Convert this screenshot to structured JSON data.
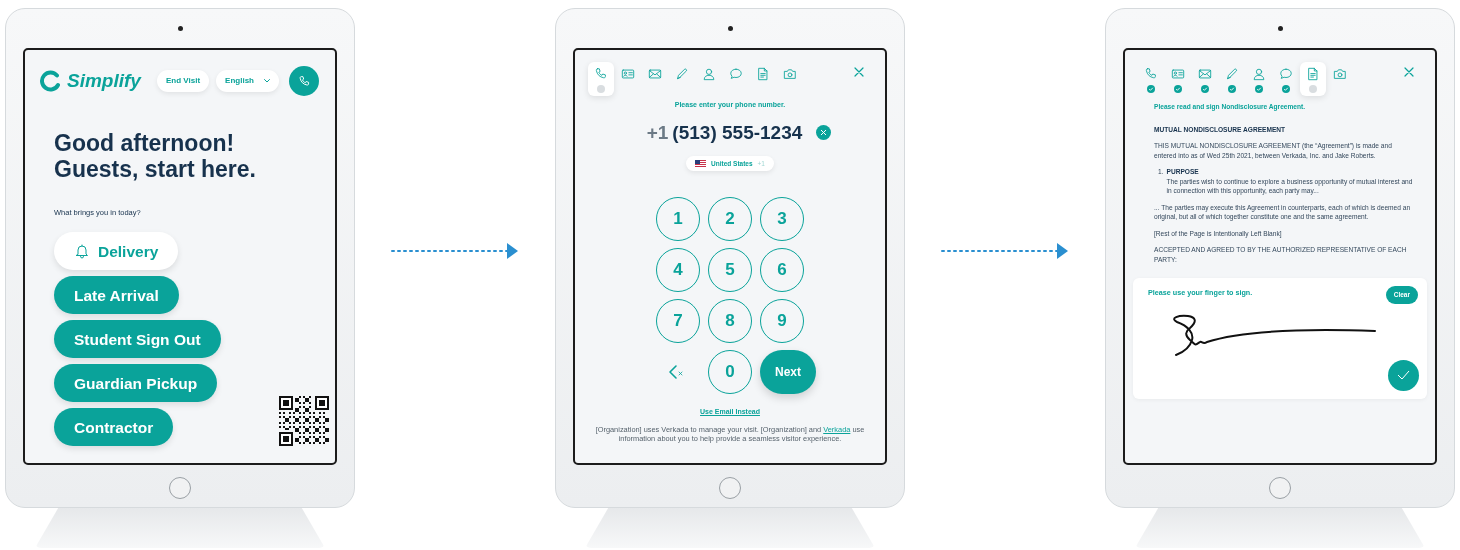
{
  "screens": [
    {
      "kind": "welcome",
      "logo": "Simplify",
      "end_visit": "End Visit",
      "language": "English",
      "greeting": [
        "Good afternoon!",
        "Guests, start here."
      ],
      "prompt": "What brings you in today?",
      "options": [
        {
          "label": "Delivery",
          "selected": true
        },
        {
          "label": "Late Arrival",
          "selected": false
        },
        {
          "label": "Student Sign Out",
          "selected": false
        },
        {
          "label": "Guardian Pickup",
          "selected": false
        },
        {
          "label": "Contractor",
          "selected": false
        }
      ]
    },
    {
      "kind": "phone",
      "steps": [
        {
          "done": false,
          "selected": true
        },
        {
          "done": false,
          "selected": false
        },
        {
          "done": false,
          "selected": false
        },
        {
          "done": false,
          "selected": false
        },
        {
          "done": false,
          "selected": false
        },
        {
          "done": false,
          "selected": false
        },
        {
          "done": false,
          "selected": false
        },
        {
          "done": false,
          "selected": false
        }
      ],
      "prompt": "Please enter your phone number.",
      "country_code": "+1",
      "phone": "(513) 555-1234",
      "country": "United States",
      "country_dial": "+1",
      "keys": [
        "1",
        "2",
        "3",
        "4",
        "5",
        "6",
        "7",
        "8",
        "9",
        "0"
      ],
      "next": "Next",
      "alt_link": "Use Email Instead",
      "footer_before": "[Organization] uses Verkada to manage your visit. [Organization] and",
      "footer_link": "Verkada",
      "footer_after": "use information about you to help provide a seamless visitor experience."
    },
    {
      "kind": "agreement",
      "steps": [
        {
          "done": true,
          "selected": false
        },
        {
          "done": true,
          "selected": false
        },
        {
          "done": true,
          "selected": false
        },
        {
          "done": true,
          "selected": false
        },
        {
          "done": true,
          "selected": false
        },
        {
          "done": true,
          "selected": false
        },
        {
          "done": false,
          "selected": true
        },
        {
          "done": false,
          "selected": false
        }
      ],
      "prompt": "Please read and sign Nondisclosure Agreement.",
      "title": "MUTUAL NONDISCLOSURE AGREEMENT",
      "intro": "THIS MUTUAL NONDISCLOSURE AGREEMENT (the “Agreement”) is made and entered into as of Wed 25th 2021, between Verkada, Inc. and Jake Roberts.",
      "sections": [
        {
          "number": "1.",
          "heading": "PURPOSE",
          "body": "The parties wish to continue to explore a business opportunity of mutual interest and in connection with this opportunity, each party may..."
        }
      ],
      "paragraphs": [
        "... The parties may execute this Agreement in counterparts, each of which is deemed an original, but all of which together constitute one and the same agreement.",
        "[Rest of the Page is Intentionally Left Blank]",
        "ACCEPTED AND AGREED TO BY THE AUTHORIZED REPRESENTATIVE OF EACH PARTY:"
      ],
      "sign_prompt": "Please use your finger to sign.",
      "clear": "Clear"
    }
  ]
}
